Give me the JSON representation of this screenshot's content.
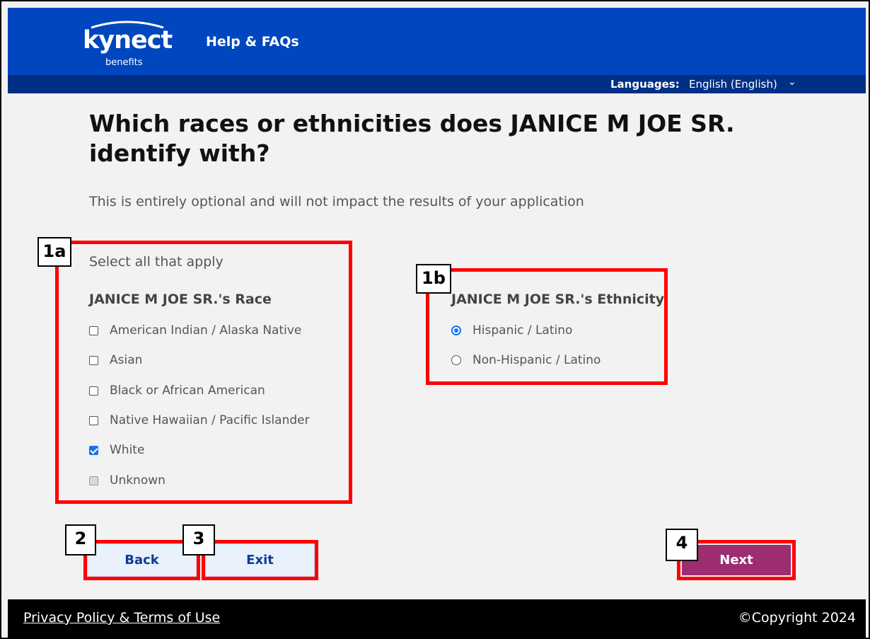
{
  "header": {
    "logo_text": "kynect",
    "logo_sub": "benefits",
    "help_link": "Help & FAQs"
  },
  "language_bar": {
    "label": "Languages:",
    "selected": "English (English)",
    "chevron_icon": "chevron-down-icon"
  },
  "page": {
    "title": "Which races or ethnicities does JANICE M JOE SR. identify with?",
    "subtitle": "This is entirely optional and will not impact the results of your application"
  },
  "race": {
    "instruction": "Select all that apply",
    "heading": "JANICE M JOE SR.'s Race",
    "options": [
      {
        "label": "American Indian / Alaska Native",
        "checked": false
      },
      {
        "label": "Asian",
        "checked": false
      },
      {
        "label": "Black or African American",
        "checked": false
      },
      {
        "label": "Native Hawaiian / Pacific Islander",
        "checked": false
      },
      {
        "label": "White",
        "checked": true
      },
      {
        "label": "Unknown",
        "checked": false,
        "disabled": true
      }
    ]
  },
  "ethnicity": {
    "heading": "JANICE M JOE SR.'s Ethnicity",
    "options": [
      {
        "label": "Hispanic / Latino",
        "selected": true
      },
      {
        "label": "Non-Hispanic / Latino",
        "selected": false
      }
    ]
  },
  "callouts": {
    "c1a": "1a",
    "c1b": "1b",
    "c2": "2",
    "c3": "3",
    "c4": "4"
  },
  "buttons": {
    "back": "Back",
    "exit": "Exit",
    "next": "Next"
  },
  "footer": {
    "privacy_link": "Privacy Policy & Terms of Use",
    "copyright": "©Copyright 2024"
  },
  "colors": {
    "header_blue": "#0046be",
    "language_bar": "#002f86",
    "callout_red": "#ff0000",
    "next_button": "#9b2d70",
    "secondary_button": "#e8f1fc",
    "checkbox_blue": "#1a73e8"
  }
}
